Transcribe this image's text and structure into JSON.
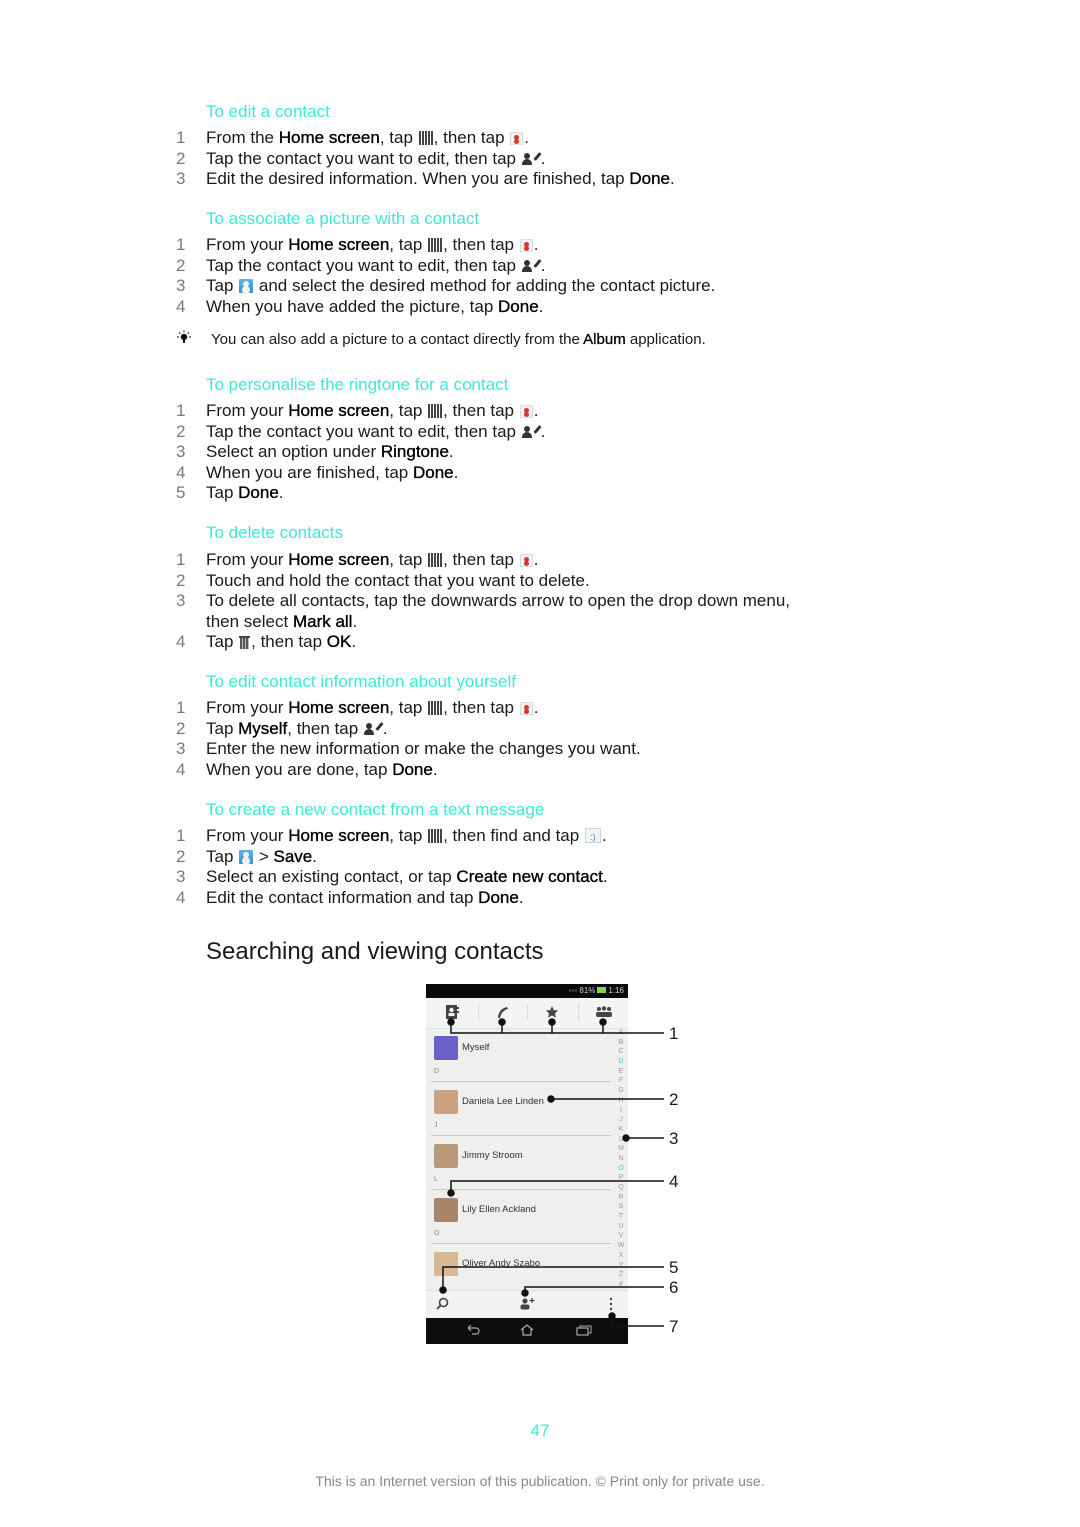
{
  "sections": [
    {
      "heading": "To edit a contact",
      "steps": [
        {
          "num": "1",
          "parts": [
            "From the ",
            "Home screen",
            ", tap ",
            "[apps-grid-icon]",
            ", then tap ",
            "[contacts-icon]",
            "."
          ]
        },
        {
          "num": "2",
          "parts": [
            "Tap the contact you want to edit, then tap ",
            "[edit-contact-icon]",
            "."
          ]
        },
        {
          "num": "3",
          "parts": [
            "Edit the desired information. When you are finished, tap ",
            "Done",
            "."
          ]
        }
      ]
    },
    {
      "heading": "To associate a picture with a contact",
      "steps": [
        {
          "num": "1",
          "parts": [
            "From your ",
            "Home screen",
            ", tap ",
            "[apps-grid-icon]",
            ", then tap ",
            "[contacts-icon]",
            "."
          ]
        },
        {
          "num": "2",
          "parts": [
            "Tap the contact you want to edit, then tap ",
            "[edit-contact-icon]",
            "."
          ]
        },
        {
          "num": "3",
          "parts": [
            "Tap ",
            "[contact-picture-icon]",
            " and select the desired method for adding the contact picture."
          ]
        },
        {
          "num": "4",
          "parts": [
            "When you have added the picture, tap ",
            "Done",
            "."
          ]
        }
      ]
    },
    {
      "heading": "To personalise the ringtone for a contact",
      "steps": [
        {
          "num": "1",
          "parts": [
            "From your ",
            "Home screen",
            ", tap ",
            "[apps-grid-icon]",
            ", then tap ",
            "[contacts-icon]",
            "."
          ]
        },
        {
          "num": "2",
          "parts": [
            "Tap the contact you want to edit, then tap ",
            "[edit-contact-icon]",
            "."
          ]
        },
        {
          "num": "3",
          "parts": [
            "Select an option under ",
            "Ringtone",
            "."
          ]
        },
        {
          "num": "4",
          "parts": [
            "When you are finished, tap ",
            "Done",
            "."
          ]
        },
        {
          "num": "5",
          "parts": [
            "Tap ",
            "Done",
            "."
          ]
        }
      ]
    },
    {
      "heading": "To delete contacts",
      "steps": [
        {
          "num": "1",
          "parts": [
            "From your ",
            "Home screen",
            ", tap ",
            "[apps-grid-icon]",
            ", then tap ",
            "[contacts-icon]",
            "."
          ]
        },
        {
          "num": "2",
          "parts": [
            "Touch and hold the contact that you want to delete."
          ]
        },
        {
          "num": "3",
          "parts": [
            "To delete all contacts, tap the downwards arrow to open the drop down menu,"
          ]
        },
        {
          "num": "",
          "parts": [
            "then select ",
            "Mark all",
            "."
          ]
        },
        {
          "num": "4",
          "parts": [
            "Tap ",
            "[trash-icon]",
            ", then tap ",
            "OK",
            "."
          ]
        }
      ]
    },
    {
      "heading": "To edit contact information about yourself",
      "steps": [
        {
          "num": "1",
          "parts": [
            "From your ",
            "Home screen",
            ", tap ",
            "[apps-grid-icon]",
            ", then tap ",
            "[contacts-icon]",
            "."
          ]
        },
        {
          "num": "2",
          "parts": [
            "Tap ",
            "Myself",
            ", then tap ",
            "[edit-contact-icon]",
            "."
          ]
        },
        {
          "num": "3",
          "parts": [
            "Enter the new information or make the changes you want."
          ]
        },
        {
          "num": "4",
          "parts": [
            "When you are done, tap ",
            "Done",
            "."
          ]
        }
      ]
    },
    {
      "heading": "To create a new contact from a text message",
      "steps": [
        {
          "num": "1",
          "parts": [
            "From your ",
            "Home screen",
            ", tap ",
            "[apps-grid-icon]",
            ", then find and tap ",
            "[messaging-icon]",
            "."
          ]
        },
        {
          "num": "2",
          "parts": [
            "Tap ",
            "[contact-picture-icon]",
            " > ",
            "Save",
            "."
          ]
        },
        {
          "num": "3",
          "parts": [
            "Select an existing contact, or tap ",
            "Create new contact",
            "."
          ]
        },
        {
          "num": "4",
          "parts": [
            "Edit the contact information and tap ",
            "Done",
            "."
          ]
        }
      ]
    }
  ],
  "tip": {
    "icon": "lightbulb-icon",
    "before": "You can also add a picture to a contact directly from the ",
    "bold": "Album",
    "after": " application."
  },
  "subheading": "Searching and viewing contacts",
  "phone": {
    "status": {
      "signal": "▪▪▪",
      "battery_pct": "81%",
      "time": "1:16"
    },
    "tabs": [
      "contacts-tab-icon",
      "phone-tab-icon",
      "favorites-tab-icon",
      "groups-tab-icon"
    ],
    "contacts": [
      {
        "section": "",
        "name": "Myself",
        "avatar": "#6a62c9"
      },
      {
        "section": "D",
        "name": "Daniela Lee Linden",
        "avatar": "#c9a27f"
      },
      {
        "section": "J",
        "name": "Jimmy Stroom",
        "avatar": "#b89a7a"
      },
      {
        "section": "L",
        "name": "Lily Ellen Ackland",
        "avatar": "#a98669"
      },
      {
        "section": "O",
        "name": "Oliver Andy Szabo",
        "avatar": "#d9b894"
      }
    ],
    "index_letters": [
      "A",
      "B",
      "C",
      "D",
      "E",
      "F",
      "G",
      "H",
      "I",
      "J",
      "K",
      "L",
      "M",
      "N",
      "O",
      "P",
      "Q",
      "R",
      "S",
      "T",
      "U",
      "V",
      "W",
      "X",
      "Y",
      "Z",
      "#"
    ],
    "index_highlight": [
      "D",
      "J",
      "L",
      "O"
    ],
    "callouts": [
      "1",
      "2",
      "3",
      "4",
      "5",
      "6",
      "7"
    ]
  },
  "page_number": "47",
  "footer": "This is an Internet version of this publication. © Print only for private use.",
  "colors": {
    "accent": "#3de8d6",
    "highlight": "#4cc6dc"
  }
}
